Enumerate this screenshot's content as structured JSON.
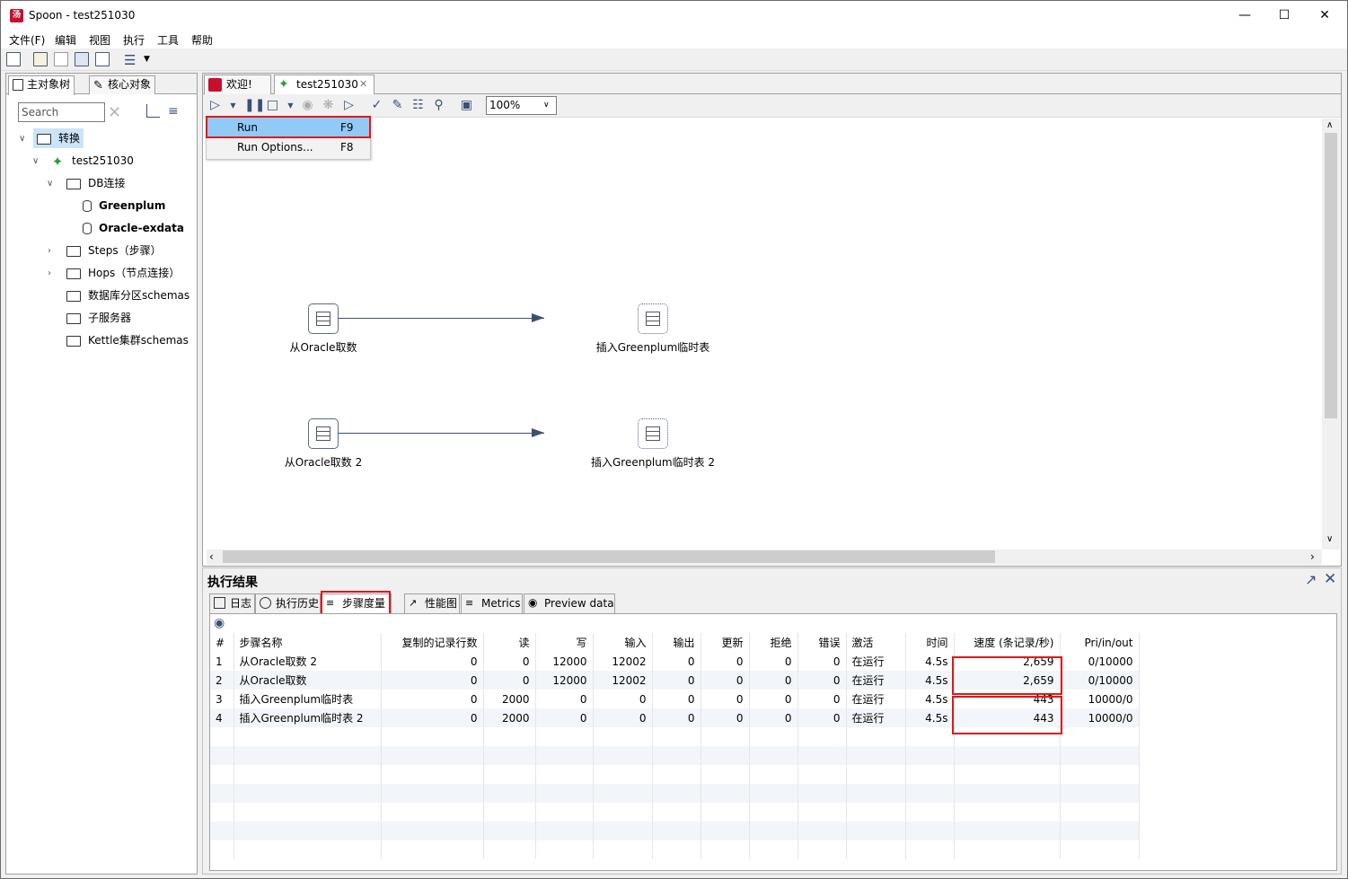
{
  "window": {
    "title": "Spoon - test251030",
    "app_icon": "spoon-app-icon",
    "controls": [
      "minimize-icon",
      "maximize-icon",
      "close-icon"
    ]
  },
  "menu": [
    "文件(F)",
    "编辑",
    "视图",
    "执行",
    "工具",
    "帮助"
  ],
  "left_panel": {
    "tabs": [
      "主对象树",
      "核心对象"
    ],
    "search_placeholder": "Search",
    "tree": {
      "root": "转换",
      "transformation": "test251030",
      "db_folder": "DB连接",
      "connections": [
        "Greenplum",
        "Oracle-exdata"
      ],
      "steps": "Steps（步骤）",
      "hops": "Hops（节点连接）",
      "partition": "数据库分区schemas",
      "slaves": "子服务器",
      "clusters": "Kettle集群schemas"
    }
  },
  "editor": {
    "tabs": [
      "欢迎!",
      "test251030"
    ],
    "zoom": "100%",
    "run_menu": [
      {
        "label": "Run",
        "shortcut": "F9"
      },
      {
        "label": "Run Options...",
        "shortcut": "F8"
      }
    ],
    "steps": [
      {
        "name": "从Oracle取数"
      },
      {
        "name": "插入Greenplum临时表"
      },
      {
        "name": "从Oracle取数 2"
      },
      {
        "name": "插入Greenplum临时表 2"
      }
    ]
  },
  "results": {
    "title": "执行结果",
    "tabs": [
      "日志",
      "执行历史",
      "步骤度量",
      "性能图",
      "Metrics",
      "Preview data"
    ],
    "columns": [
      "#",
      "步骤名称",
      "复制的记录行数",
      "读",
      "写",
      "输入",
      "输出",
      "更新",
      "拒绝",
      "错误",
      "激活",
      "时间",
      "速度 (条记录/秒)",
      "Pri/in/out"
    ],
    "rows": [
      [
        "1",
        "从Oracle取数 2",
        "0",
        "0",
        "12000",
        "12002",
        "0",
        "0",
        "0",
        "0",
        "在运行",
        "4.5s",
        "2,659",
        "0/10000"
      ],
      [
        "2",
        "从Oracle取数",
        "0",
        "0",
        "12000",
        "12002",
        "0",
        "0",
        "0",
        "0",
        "在运行",
        "4.5s",
        "2,659",
        "0/10000"
      ],
      [
        "3",
        "插入Greenplum临时表",
        "0",
        "2000",
        "0",
        "0",
        "0",
        "0",
        "0",
        "0",
        "在运行",
        "4.5s",
        "443",
        "10000/0"
      ],
      [
        "4",
        "插入Greenplum临时表 2",
        "0",
        "2000",
        "0",
        "0",
        "0",
        "0",
        "0",
        "0",
        "在运行",
        "4.5s",
        "443",
        "10000/0"
      ]
    ]
  }
}
